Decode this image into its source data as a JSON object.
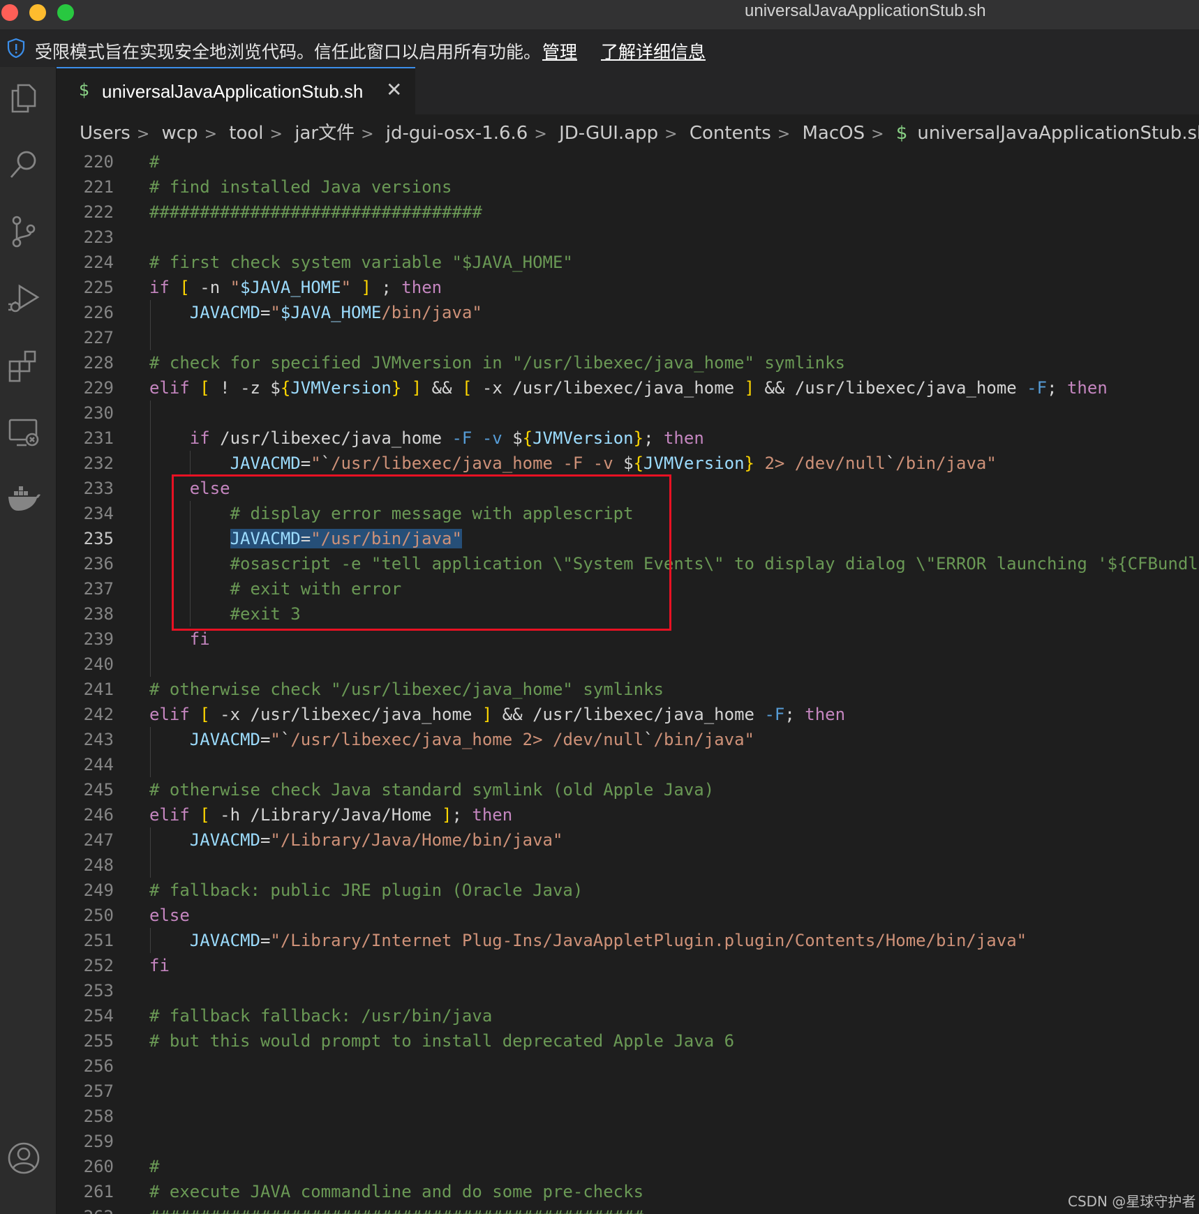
{
  "window": {
    "title": "universalJavaApplicationStub.sh"
  },
  "banner": {
    "message": "受限模式旨在实现安全地浏览代码。信任此窗口以启用所有功能。",
    "manage_link": "管理",
    "learn_more_link": "了解详细信息"
  },
  "activity_bar": {
    "icons": [
      "explorer-icon",
      "search-icon",
      "source-control-icon",
      "run-debug-icon",
      "extensions-icon",
      "remote-explorer-icon",
      "docker-icon",
      "account-icon"
    ]
  },
  "tab": {
    "label": "universalJavaApplicationStub.sh",
    "icon": "$",
    "close": "✕"
  },
  "breadcrumb": {
    "items": [
      "Users",
      "wcp",
      "tool",
      "jar文件",
      "jd-gui-osx-1.6.6",
      "JD-GUI.app",
      "Contents",
      "MacOS"
    ],
    "file": "universalJavaApplicationStub.sh",
    "file_icon": "$",
    "separator": ">"
  },
  "editor": {
    "language": "shellscript",
    "active_line": 235,
    "selection": "JAVACMD=\"/usr/bin/java\"",
    "colors": {
      "comment": "#6a9955",
      "keyword": "#c586c0",
      "string": "#ce9178",
      "variable": "#9cdcfe",
      "bracket": "#ffd700",
      "flag": "#569cd6",
      "highlight_box": "#e81123"
    },
    "lines": [
      {
        "n": 220,
        "text": "#"
      },
      {
        "n": 221,
        "text": "# find installed Java versions"
      },
      {
        "n": 222,
        "text": "#################################"
      },
      {
        "n": 223,
        "text": ""
      },
      {
        "n": 224,
        "text": "# first check system variable \"$JAVA_HOME\""
      },
      {
        "n": 225,
        "text": "if [ -n \"$JAVA_HOME\" ] ; then"
      },
      {
        "n": 226,
        "text": "    JAVACMD=\"$JAVA_HOME/bin/java\""
      },
      {
        "n": 227,
        "text": ""
      },
      {
        "n": 228,
        "text": "# check for specified JVMversion in \"/usr/libexec/java_home\" symlinks"
      },
      {
        "n": 229,
        "text": "elif [ ! -z ${JVMVersion} ] && [ -x /usr/libexec/java_home ] && /usr/libexec/java_home -F; then"
      },
      {
        "n": 230,
        "text": ""
      },
      {
        "n": 231,
        "text": "    if /usr/libexec/java_home -F -v ${JVMVersion}; then"
      },
      {
        "n": 232,
        "text": "        JAVACMD=\"`/usr/libexec/java_home -F -v ${JVMVersion} 2> /dev/null`/bin/java\""
      },
      {
        "n": 233,
        "text": "    else"
      },
      {
        "n": 234,
        "text": "        # display error message with applescript"
      },
      {
        "n": 235,
        "text": "        JAVACMD=\"/usr/bin/java\""
      },
      {
        "n": 236,
        "text": "        #osascript -e \"tell application \\\"System Events\\\" to display dialog \\\"ERROR launching '${CFBundl"
      },
      {
        "n": 237,
        "text": "        # exit with error"
      },
      {
        "n": 238,
        "text": "        #exit 3"
      },
      {
        "n": 239,
        "text": "    fi"
      },
      {
        "n": 240,
        "text": ""
      },
      {
        "n": 241,
        "text": "# otherwise check \"/usr/libexec/java_home\" symlinks"
      },
      {
        "n": 242,
        "text": "elif [ -x /usr/libexec/java_home ] && /usr/libexec/java_home -F; then"
      },
      {
        "n": 243,
        "text": "    JAVACMD=\"`/usr/libexec/java_home 2> /dev/null`/bin/java\""
      },
      {
        "n": 244,
        "text": ""
      },
      {
        "n": 245,
        "text": "# otherwise check Java standard symlink (old Apple Java)"
      },
      {
        "n": 246,
        "text": "elif [ -h /Library/Java/Home ]; then"
      },
      {
        "n": 247,
        "text": "    JAVACMD=\"/Library/Java/Home/bin/java\""
      },
      {
        "n": 248,
        "text": ""
      },
      {
        "n": 249,
        "text": "# fallback: public JRE plugin (Oracle Java)"
      },
      {
        "n": 250,
        "text": "else"
      },
      {
        "n": 251,
        "text": "    JAVACMD=\"/Library/Internet Plug-Ins/JavaAppletPlugin.plugin/Contents/Home/bin/java\""
      },
      {
        "n": 252,
        "text": "fi"
      },
      {
        "n": 253,
        "text": ""
      },
      {
        "n": 254,
        "text": "# fallback fallback: /usr/bin/java"
      },
      {
        "n": 255,
        "text": "# but this would prompt to install deprecated Apple Java 6"
      },
      {
        "n": 256,
        "text": ""
      },
      {
        "n": 257,
        "text": ""
      },
      {
        "n": 258,
        "text": ""
      },
      {
        "n": 259,
        "text": ""
      },
      {
        "n": 260,
        "text": "#"
      },
      {
        "n": 261,
        "text": "# execute JAVA commandline and do some pre-checks"
      },
      {
        "n": 262,
        "text": "#################################################"
      }
    ]
  },
  "watermark": "CSDN @星球守护者"
}
